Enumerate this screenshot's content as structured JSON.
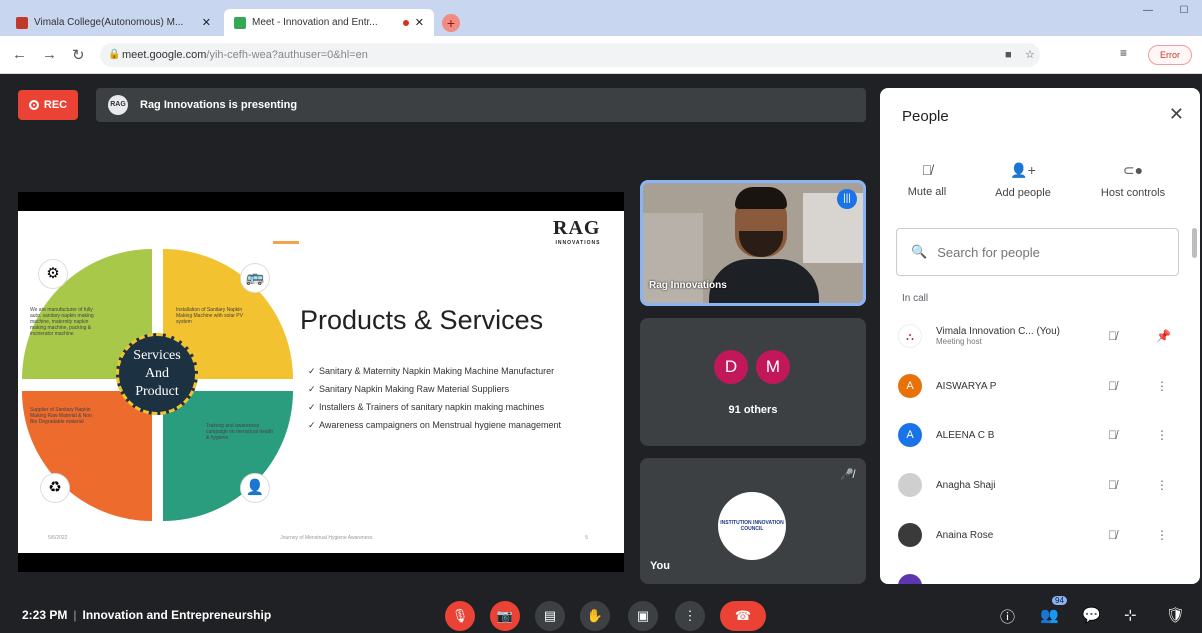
{
  "browser": {
    "tabs": [
      {
        "title": "Vimala College(Autonomous) M..."
      },
      {
        "title": "Meet - Innovation and Entr..."
      }
    ],
    "url_host": "meet.google.com",
    "url_path": "/yih-cefh-wea?authuser=0&hl=en",
    "profile_label": "Error"
  },
  "meet": {
    "rec_label": "REC",
    "presenting_text": "Rag Innovations is presenting",
    "presenter_avatar": "RAG",
    "time": "2:23 PM",
    "meeting_title": "Innovation and Entrepreneurship",
    "participants_badge": "94"
  },
  "slide": {
    "logo": "RAG",
    "logo_sub": "INNOVATIONS",
    "title": "Products & Services",
    "center_text": [
      "Services",
      "And",
      "Product"
    ],
    "bullets": [
      "Sanitary & Maternity Napkin Making Machine Manufacturer",
      "Sanitary Napkin Making Raw Material Suppliers",
      "Installers & Trainers of sanitary napkin making machines",
      "Awareness campaigners on Menstrual hygiene management"
    ],
    "quad_texts": [
      "We are manufacturer of fully auto, sanitary napkin making machine, maternity napkin making machine, packing & incinerator machine",
      "Installation of Sanitary Napkin Making Machine with solar PV system",
      "Supplier of Sanitary Napkin Making Raw Material & Non Bio Degradable material",
      "Training and awareness campaign on menstrual health & hygiene"
    ],
    "footer_left": "5/6/2022",
    "footer_mid": "Journey of Menstrual Hygiene Awareness",
    "footer_right": "5"
  },
  "tiles": {
    "speaker_name": "Rag Innovations",
    "others_avatars": [
      "D",
      "M"
    ],
    "others_label": "91 others",
    "you_label": "You",
    "you_logo_text": "INSTITUTION INNOVATION COUNCIL"
  },
  "people": {
    "title": "People",
    "controls": [
      {
        "label": "Mute all",
        "icon": "mic-off-icon"
      },
      {
        "label": "Add people",
        "icon": "add-person-icon"
      },
      {
        "label": "Host controls",
        "icon": "toggle-icon"
      }
    ],
    "search_placeholder": "Search for people",
    "section_label": "In call",
    "participants": [
      {
        "name": "Vimala Innovation C...",
        "suffix": "(You)",
        "sub": "Meeting host",
        "initial": "",
        "color": "#ffffff"
      },
      {
        "name": "AISWARYA P",
        "suffix": "",
        "sub": "",
        "initial": "A",
        "color": "#e8710a"
      },
      {
        "name": "ALEENA C B",
        "suffix": "",
        "sub": "",
        "initial": "A",
        "color": "#1a73e8"
      },
      {
        "name": "Anagha Shaji",
        "suffix": "",
        "sub": "",
        "initial": "",
        "color": "#cfcfcf"
      },
      {
        "name": "Anaina Rose",
        "suffix": "",
        "sub": "",
        "initial": "",
        "color": "#3a3a3a"
      }
    ]
  }
}
